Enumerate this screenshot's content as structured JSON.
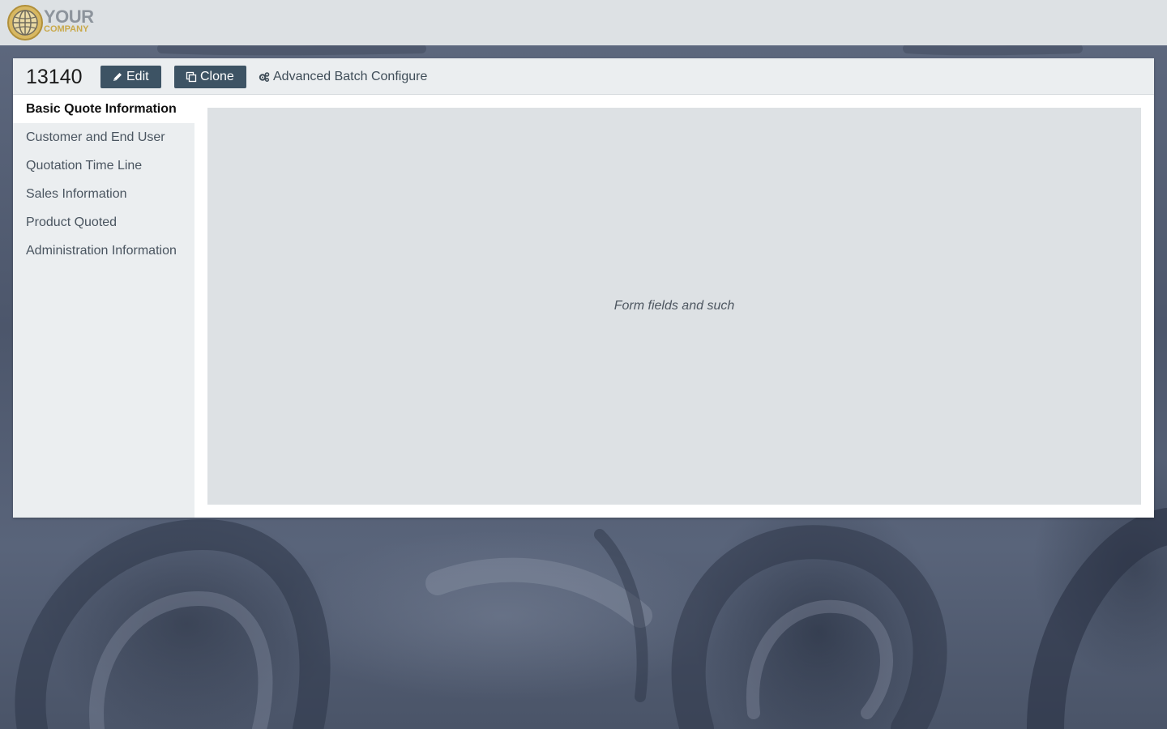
{
  "branding": {
    "logo_line1": "YOUR",
    "logo_line2": "COMPANY",
    "logo_icon": "globe-icon"
  },
  "record": {
    "id": "13140"
  },
  "toolbar": {
    "edit_label": "Edit",
    "edit_icon": "pencil-icon",
    "clone_label": "Clone",
    "clone_icon": "copy-icon",
    "batch_label": "Advanced Batch Configure",
    "batch_icon": "gears-icon"
  },
  "sidebar": {
    "items": [
      {
        "label": "Basic Quote Information",
        "active": true
      },
      {
        "label": "Customer and End User",
        "active": false
      },
      {
        "label": "Quotation Time Line",
        "active": false
      },
      {
        "label": "Sales Information",
        "active": false
      },
      {
        "label": "Product Quoted",
        "active": false
      },
      {
        "label": "Administration Information",
        "active": false
      }
    ]
  },
  "main": {
    "placeholder_text": "Form fields and such"
  },
  "colors": {
    "topbar_bg": "#dde1e4",
    "button_bg": "#3d5364",
    "sidebar_bg": "#ebeef0",
    "content_bg": "#dde1e4",
    "logo_gold": "#c9a94a"
  }
}
